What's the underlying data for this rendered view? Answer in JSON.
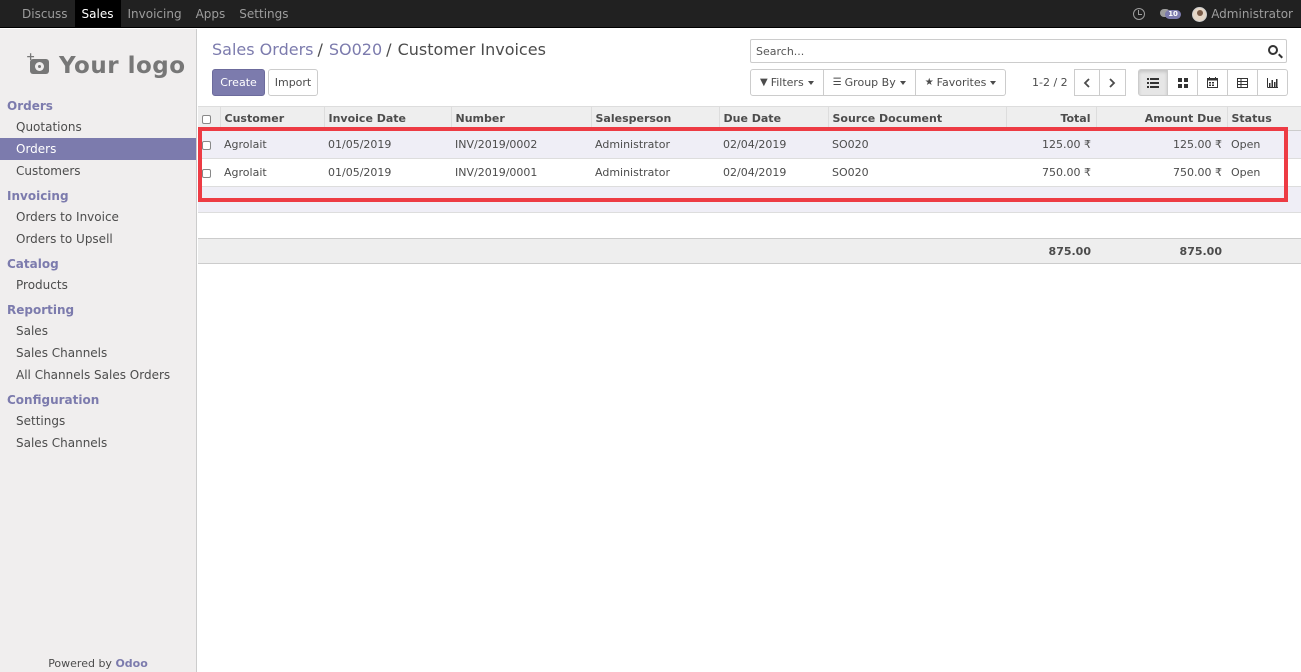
{
  "topbar": {
    "menus": [
      "Discuss",
      "Sales",
      "Invoicing",
      "Apps",
      "Settings"
    ],
    "active_menu": "Sales",
    "chat_count": "10",
    "user_name": "Administrator"
  },
  "sidebar": {
    "logo_text": "Your logo",
    "sections": [
      {
        "title": "Orders",
        "items": [
          "Quotations",
          "Orders",
          "Customers"
        ]
      },
      {
        "title": "Invoicing",
        "items": [
          "Orders to Invoice",
          "Orders to Upsell"
        ]
      },
      {
        "title": "Catalog",
        "items": [
          "Products"
        ]
      },
      {
        "title": "Reporting",
        "items": [
          "Sales",
          "Sales Channels",
          "All Channels Sales Orders"
        ]
      },
      {
        "title": "Configuration",
        "items": [
          "Settings",
          "Sales Channels"
        ]
      }
    ],
    "active_item": "Orders",
    "powered_prefix": "Powered by",
    "powered_brand": "Odoo"
  },
  "breadcrumb": {
    "items": [
      "Sales Orders",
      "SO020"
    ],
    "current": "Customer Invoices"
  },
  "buttons": {
    "create": "Create",
    "import": "Import"
  },
  "search": {
    "placeholder": "Search..."
  },
  "filters": {
    "filters_label": "Filters",
    "group_by_label": "Group By",
    "favorites_label": "Favorites"
  },
  "pager": {
    "value": "1-2 / 2"
  },
  "table": {
    "columns": [
      "Customer",
      "Invoice Date",
      "Number",
      "Salesperson",
      "Due Date",
      "Source Document",
      "Total",
      "Amount Due",
      "Status"
    ],
    "rows": [
      {
        "customer": "Agrolait",
        "invoice_date": "01/05/2019",
        "number": "INV/2019/0002",
        "salesperson": "Administrator",
        "due_date": "02/04/2019",
        "source": "SO020",
        "total": "125.00 ₹",
        "amount_due": "125.00 ₹",
        "status": "Open"
      },
      {
        "customer": "Agrolait",
        "invoice_date": "01/05/2019",
        "number": "INV/2019/0001",
        "salesperson": "Administrator",
        "due_date": "02/04/2019",
        "source": "SO020",
        "total": "750.00 ₹",
        "amount_due": "750.00 ₹",
        "status": "Open"
      }
    ],
    "footer": {
      "total": "875.00",
      "amount_due": "875.00"
    }
  },
  "colors": {
    "brand": "#7c7bad",
    "highlight": "#ed3b44",
    "topbar": "#212121"
  }
}
